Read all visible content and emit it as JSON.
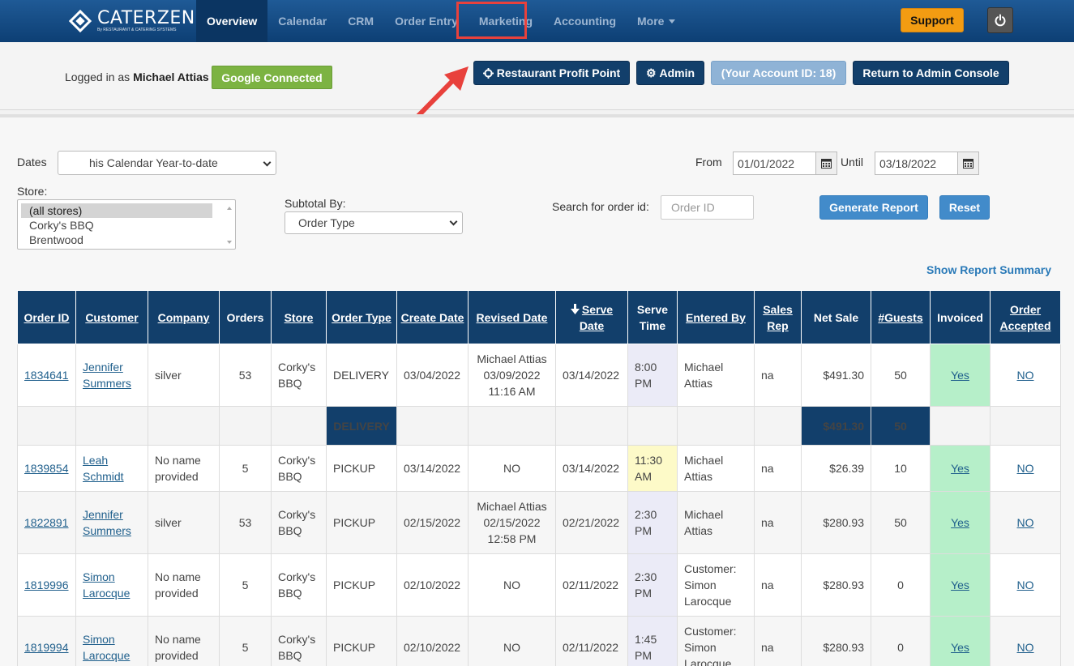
{
  "brand": {
    "name": "CATERZEN",
    "tagline": "By RESTAURANT & CATERING SYSTEMS"
  },
  "nav": {
    "items": [
      {
        "label": "Overview",
        "active": true
      },
      {
        "label": "Calendar"
      },
      {
        "label": "CRM"
      },
      {
        "label": "Order Entry"
      },
      {
        "label": "Marketing",
        "highlighted": true
      },
      {
        "label": "Accounting"
      },
      {
        "label": "More"
      }
    ],
    "support_label": "Support",
    "power_icon": "power-icon"
  },
  "header": {
    "logged_in_prefix": "Logged in as",
    "user_name": "Michael Attias",
    "google_label": "Google Connected",
    "profit_point_label": "Restaurant Profit Point",
    "admin_label": "Admin",
    "account_id_label": "(Your Account ID: 18)",
    "return_label": "Return to Admin Console"
  },
  "filters": {
    "dates_label": "Dates",
    "dates_value": "his Calendar Year-to-date",
    "from_label": "From",
    "from_value": "01/01/2022",
    "until_label": "Until",
    "until_value": "03/18/2022",
    "store_label": "Store:",
    "stores": [
      "(all stores)",
      "Corky's BBQ",
      "Brentwood"
    ],
    "subtotal_label": "Subtotal By:",
    "subtotal_value": "Order Type",
    "search_label": "Search for order id:",
    "search_placeholder": "Order ID",
    "generate_label": "Generate Report",
    "reset_label": "Reset",
    "summary_link": "Show Report Summary"
  },
  "table": {
    "headers": {
      "order_id": "Order ID",
      "customer": "Customer",
      "company": "Company",
      "orders": "Orders",
      "store": "Store",
      "order_type": "Order Type",
      "create_date": "Create Date",
      "revised_date": "Revised Date",
      "serve_date": "Serve Date",
      "serve_time": "Serve Time",
      "entered_by": "Entered By",
      "sales_rep": "Sales Rep",
      "net_sale": "Net Sale",
      "guests": "#Guests",
      "invoiced": "Invoiced",
      "order_accepted": "Order Accepted"
    },
    "rows": [
      {
        "id": "1834641",
        "customer": "Jennifer Summers",
        "company": "silver",
        "orders": "53",
        "store": "Corky's BBQ",
        "type": "DELIVERY",
        "create": "03/04/2022",
        "revised": "Michael Attias 03/09/2022 11:16 AM",
        "serve": "03/14/2022",
        "time": "8:00 PM",
        "entered": "Michael Attias",
        "rep": "na",
        "net": "$491.30",
        "guests": "50",
        "invoiced": "Yes",
        "accepted": "NO"
      },
      {
        "id": "1839854",
        "customer": "Leah Schmidt",
        "company": "No name provided",
        "orders": "5",
        "store": "Corky's BBQ",
        "type": "PICKUP",
        "create": "03/14/2022",
        "revised": "NO",
        "serve": "03/14/2022",
        "time": "11:30 AM",
        "entered": "Michael Attias",
        "rep": "na",
        "net": "$26.39",
        "guests": "10",
        "invoiced": "Yes",
        "accepted": "NO"
      },
      {
        "id": "1822891",
        "customer": "Jennifer Summers",
        "company": "silver",
        "orders": "53",
        "store": "Corky's BBQ",
        "type": "PICKUP",
        "create": "02/15/2022",
        "revised": "Michael Attias 02/15/2022 12:58 PM",
        "serve": "02/21/2022",
        "time": "2:30 PM",
        "entered": "Michael Attias",
        "rep": "na",
        "net": "$280.93",
        "guests": "50",
        "invoiced": "Yes",
        "accepted": "NO"
      },
      {
        "id": "1819996",
        "customer": "Simon Larocque",
        "company": "No name provided",
        "orders": "5",
        "store": "Corky's BBQ",
        "type": "PICKUP",
        "create": "02/10/2022",
        "revised": "NO",
        "serve": "02/11/2022",
        "time": "2:30 PM",
        "entered": "Customer: Simon Larocque",
        "rep": "na",
        "net": "$280.93",
        "guests": "0",
        "invoiced": "Yes",
        "accepted": "NO"
      },
      {
        "id": "1819994",
        "customer": "Simon Larocque",
        "company": "No name provided",
        "orders": "5",
        "store": "Corky's BBQ",
        "type": "PICKUP",
        "create": "02/10/2022",
        "revised": "NO",
        "serve": "02/11/2022",
        "time": "1:45 PM",
        "entered": "Customer: Simon Larocque",
        "rep": "na",
        "net": "$280.93",
        "guests": "0",
        "invoiced": "Yes",
        "accepted": "NO"
      }
    ],
    "subtotal": {
      "type": "DELIVERY",
      "net": "$491.30",
      "guests": "50"
    }
  },
  "colors": {
    "nav": "#0d3f74",
    "header_dark": "#123f6b",
    "accent_orange": "#f39c12",
    "google_green": "#7cb342",
    "invoiced_green": "#b6efc9",
    "highlight_red": "#e8413c"
  }
}
